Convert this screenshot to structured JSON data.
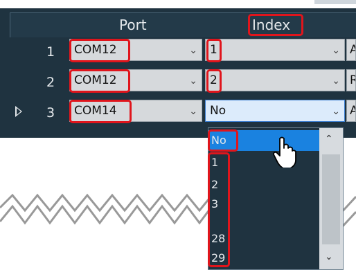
{
  "grid": {
    "columns": {
      "port": "Port",
      "index": "Index"
    },
    "rows": [
      {
        "num": "1",
        "port": "COM12",
        "index": "1",
        "extra": "A",
        "selected": false
      },
      {
        "num": "2",
        "port": "COM12",
        "index": "2",
        "extra": "R",
        "selected": false
      },
      {
        "num": "3",
        "port": "COM14",
        "index": "No",
        "extra": "A",
        "selected": true
      }
    ]
  },
  "dropdown": {
    "selected": "No",
    "options": [
      "No",
      "1",
      "2",
      "3",
      "28",
      "29"
    ]
  },
  "icons": {
    "combo_arrow": "chevron-down-icon",
    "row_marker": "current-row-arrow-icon",
    "scroll_up": "chevron-up-icon",
    "scroll_down": "chevron-down-icon",
    "cursor": "hand-pointer-cursor-icon"
  },
  "colors": {
    "grid_background": "#1f3340",
    "highlight_border": "#e0151c",
    "dropdown_selection": "#1a82e0"
  }
}
